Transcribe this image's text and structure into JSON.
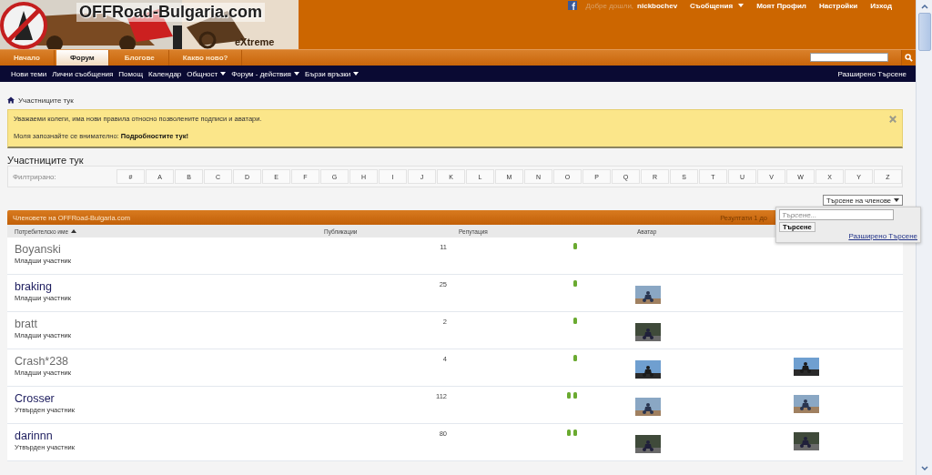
{
  "header": {
    "logo_text": "OFFRoad-Bulgaria.com",
    "logo_subtext": "eXtreme",
    "user_links": [
      {
        "kind": "greeting",
        "label": "Добре дошли,"
      },
      {
        "kind": "user",
        "label": "nickbochev"
      },
      {
        "kind": "dropdown",
        "label": "Съобщения"
      },
      {
        "kind": "link",
        "label": "Моят Профил"
      },
      {
        "kind": "link",
        "label": "Настройки"
      },
      {
        "kind": "link",
        "label": "Изход"
      }
    ]
  },
  "tabs": [
    {
      "label": "Начало",
      "selected": false
    },
    {
      "label": "Форум",
      "selected": true
    },
    {
      "label": "Блогове",
      "selected": false
    },
    {
      "label": "Какво ново?",
      "selected": false
    }
  ],
  "nav": {
    "links": [
      {
        "label": "Нови теми",
        "dropdown": false
      },
      {
        "label": "Лични съобщения",
        "dropdown": false
      },
      {
        "label": "Помощ",
        "dropdown": false
      },
      {
        "label": "Календар",
        "dropdown": false
      },
      {
        "label": "Общност",
        "dropdown": true
      },
      {
        "label": "Форум - действия",
        "dropdown": true
      },
      {
        "label": "Бързи връзки",
        "dropdown": true
      }
    ],
    "advanced_search": "Разширено Търсене"
  },
  "breadcrumb": "Участниците тук",
  "notice": {
    "line": "Уважаеми колеги, има нови правила относно позволените подписи и аватари.",
    "text": "Моля запознайте се внимателно:",
    "link": "Подробностите тук!"
  },
  "heading": "Участниците тук",
  "filter": {
    "label": "Филтрирано:",
    "letters": [
      "#",
      "A",
      "B",
      "C",
      "D",
      "E",
      "F",
      "G",
      "H",
      "I",
      "J",
      "K",
      "L",
      "M",
      "N",
      "O",
      "P",
      "Q",
      "R",
      "S",
      "T",
      "U",
      "V",
      "W",
      "X",
      "Y",
      "Z"
    ]
  },
  "member_search_button": "Търсене на членове",
  "search_popup": {
    "placeholder": "Търсене...",
    "button": "Търсене",
    "link": "Разширено Търсене"
  },
  "table": {
    "title": "Членовете на OFFRoad-Bulgaria.com",
    "results": "Резултати 1 до",
    "columns": [
      {
        "label": "Потребителско име",
        "sorted": true
      },
      {
        "label": "Публикации",
        "sorted": false
      },
      {
        "label": "Репутация",
        "sorted": false
      },
      {
        "label": "Аватар",
        "sorted": false
      }
    ],
    "rows": [
      {
        "name": "Boyanski",
        "color": "#6b6b6b",
        "title": "Младши участник",
        "posts": "11",
        "reputation": [
          {
            "kind": "pip"
          }
        ]
      },
      {
        "name": "braking",
        "color": "#1c1c5e",
        "title": "Младши участник",
        "posts": "25",
        "reputation": [
          {
            "kind": "pip"
          }
        ],
        "avatar": {
          "kind": "picture"
        }
      },
      {
        "name": "bratt",
        "color": "#6b6b6b",
        "title": "Младши участник",
        "posts": "2",
        "reputation": [
          {
            "kind": "pip"
          }
        ],
        "avatar": {
          "kind": "picture"
        }
      },
      {
        "name": "Crash*238",
        "color": "#6b6b6b",
        "title": "Младши участник",
        "posts": "4",
        "reputation": [
          {
            "kind": "pip"
          }
        ],
        "avatar": {
          "kind": "picture"
        },
        "photo": {
          "kind": "picture"
        }
      },
      {
        "name": "Crosser",
        "color": "#1c1c5e",
        "title": "Утвърден участник",
        "posts": "112",
        "reputation": [
          {
            "kind": "pip"
          },
          {
            "kind": "pip"
          }
        ],
        "avatar": {
          "kind": "picture"
        },
        "photo": {
          "kind": "picture"
        }
      },
      {
        "name": "darinnn",
        "color": "#1c1c5e",
        "title": "Утвърден участник",
        "posts": "80",
        "reputation": [
          {
            "kind": "pip"
          },
          {
            "kind": "pip"
          }
        ],
        "avatar": {
          "kind": "picture"
        },
        "photo": {
          "kind": "picture"
        }
      }
    ]
  }
}
